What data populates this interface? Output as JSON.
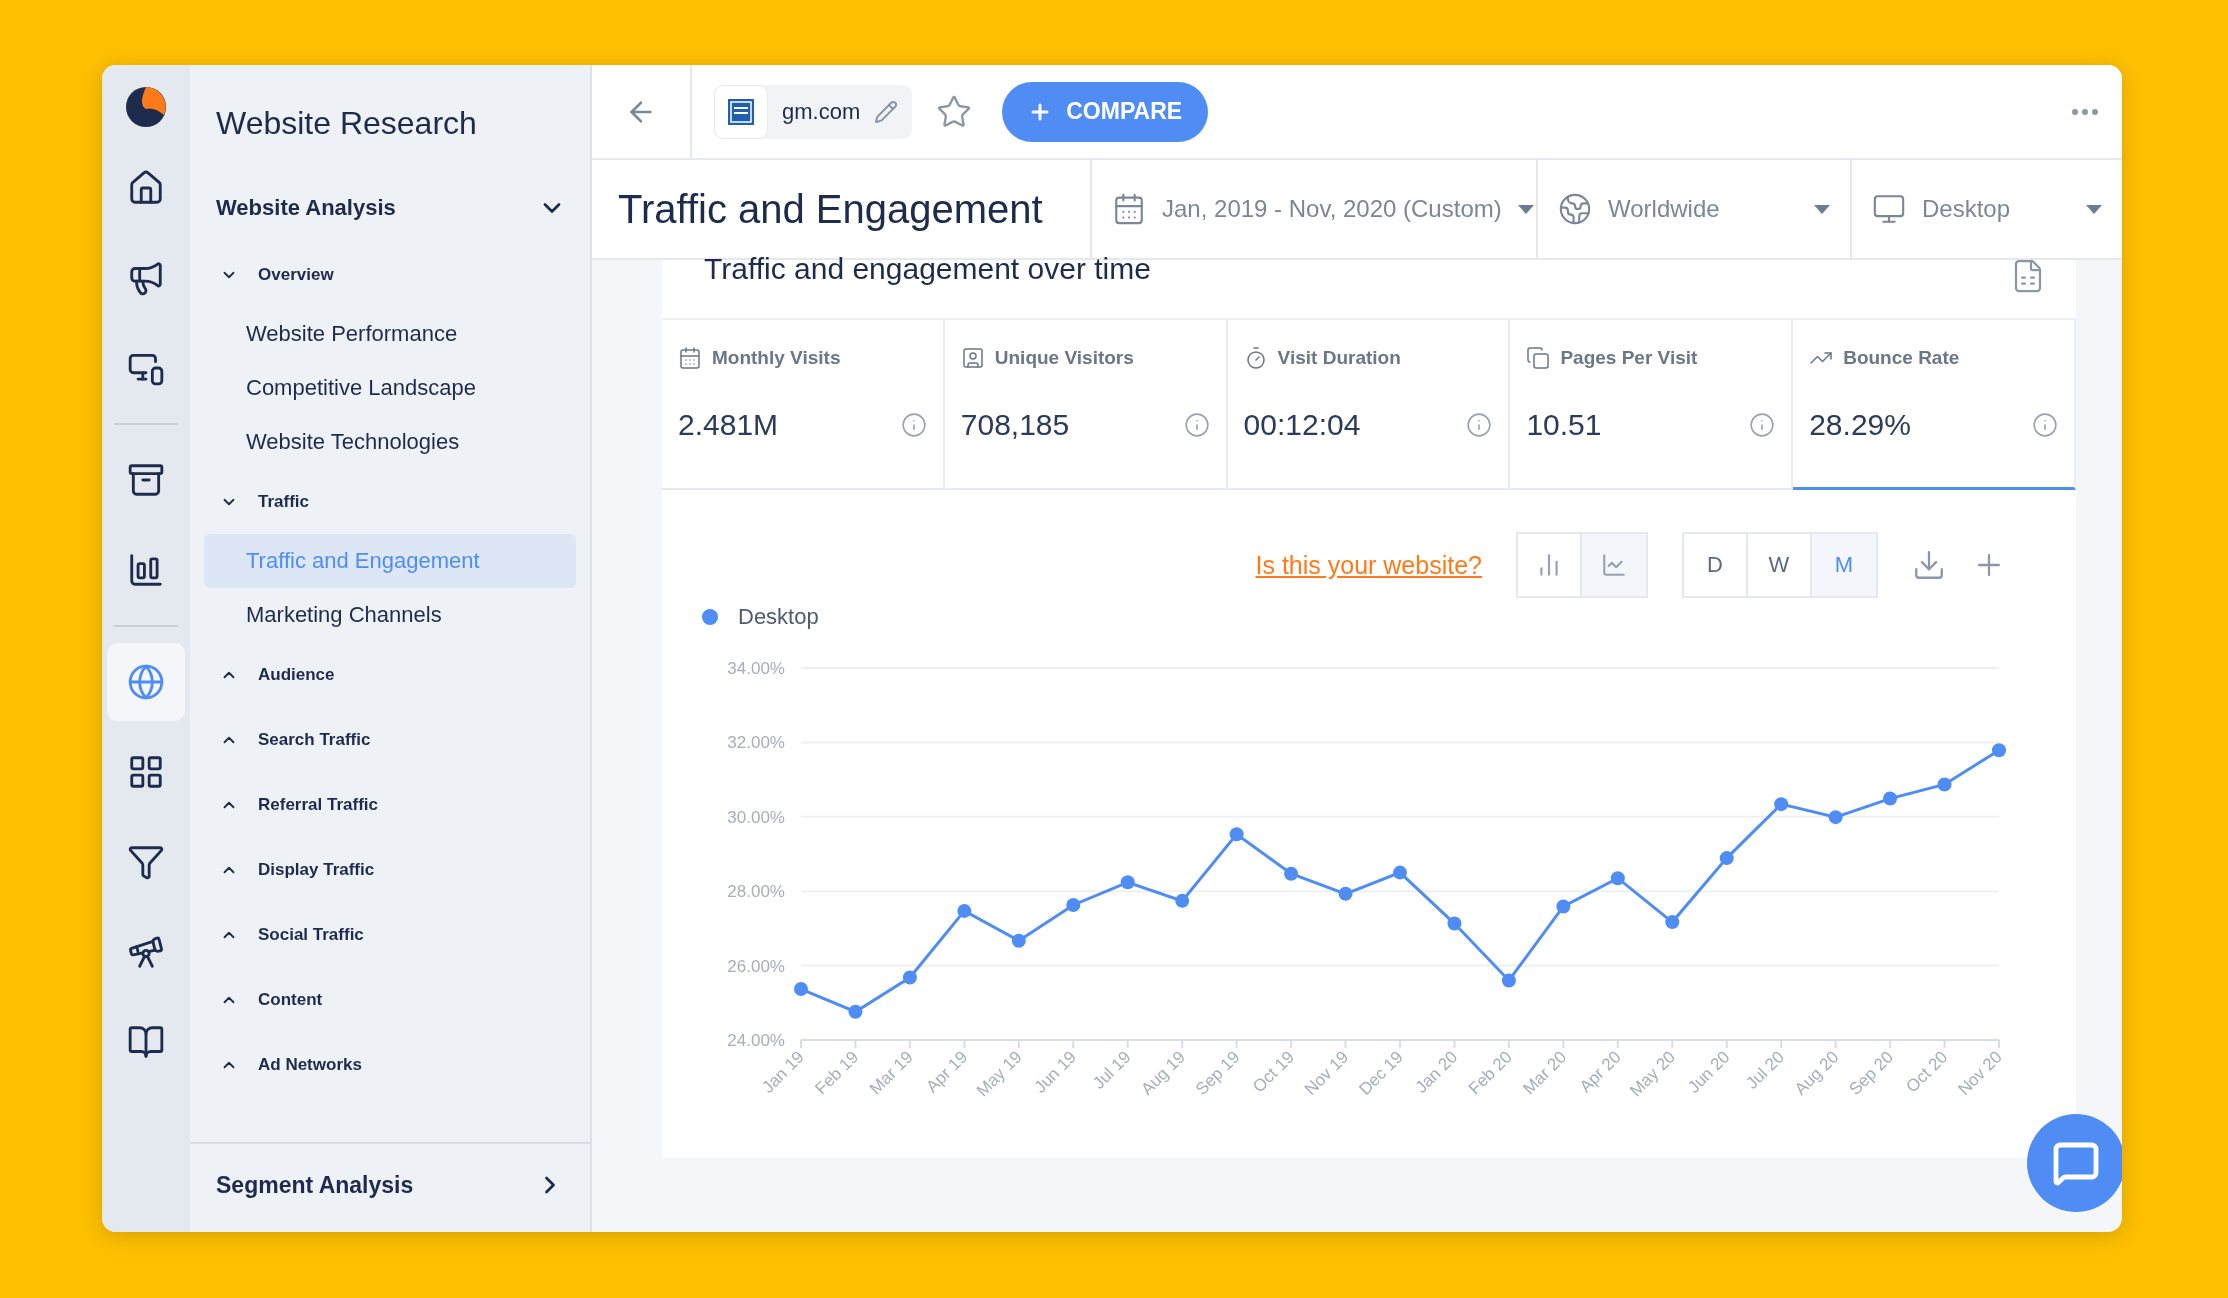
{
  "rail": {
    "groups": [
      [
        {
          "selected": false
        },
        {
          "selected": false
        },
        {
          "selected": false
        }
      ],
      [
        {
          "selected": false
        },
        {
          "selected": false
        }
      ],
      [
        {
          "selected": true
        },
        {
          "selected": false
        },
        {
          "selected": false
        },
        {
          "selected": false
        },
        {
          "selected": false
        }
      ]
    ]
  },
  "sidebar": {
    "title": "Website Research",
    "section": {
      "label": "Website Analysis",
      "expanded": true
    },
    "groups": [
      {
        "label": "Overview",
        "expanded": true,
        "children": [
          {
            "label": "Website Performance",
            "selected": false
          },
          {
            "label": "Competitive Landscape",
            "selected": false
          },
          {
            "label": "Website Technologies",
            "selected": false
          }
        ]
      },
      {
        "label": "Traffic",
        "expanded": true,
        "children": [
          {
            "label": "Traffic and Engagement",
            "selected": true
          },
          {
            "label": "Marketing Channels",
            "selected": false
          }
        ]
      },
      {
        "label": "Audience",
        "expanded": false
      },
      {
        "label": "Search Traffic",
        "expanded": false
      },
      {
        "label": "Referral Traffic",
        "expanded": false
      },
      {
        "label": "Display Traffic",
        "expanded": false
      },
      {
        "label": "Social Traffic",
        "expanded": false
      },
      {
        "label": "Content",
        "expanded": false
      },
      {
        "label": "Ad Networks",
        "expanded": false
      }
    ],
    "footer": "Segment Analysis"
  },
  "topbar": {
    "domain": "gm.com",
    "compare": "COMPARE"
  },
  "header": {
    "title": "Traffic and Engagement",
    "filters": [
      {
        "kind": "date",
        "value": "Jan, 2019 - Nov, 2020 (Custom)"
      },
      {
        "kind": "country",
        "value": "Worldwide"
      },
      {
        "kind": "device",
        "value": "Desktop"
      }
    ]
  },
  "card": {
    "title": "Traffic and engagement over time",
    "metrics": [
      {
        "label": "Monthly Visits",
        "value": "2.481M",
        "selected": false
      },
      {
        "label": "Unique Visitors",
        "value": "708,185",
        "selected": false
      },
      {
        "label": "Visit Duration",
        "value": "00:12:04",
        "selected": false
      },
      {
        "label": "Pages Per Visit",
        "value": "10.51",
        "selected": false
      },
      {
        "label": "Bounce Rate",
        "value": "28.29%",
        "selected": true
      }
    ],
    "claim_link": "Is this your website?",
    "chart_types": [
      {
        "kind": "bar",
        "selected": false
      },
      {
        "kind": "line",
        "selected": true
      }
    ],
    "granularity": [
      {
        "label": "D",
        "selected": false
      },
      {
        "label": "W",
        "selected": false
      },
      {
        "label": "M",
        "selected": true
      }
    ],
    "chart_data": {
      "type": "line",
      "categories": [
        "Jan 19",
        "Feb 19",
        "Mar 19",
        "Apr 19",
        "May 19",
        "Jun 19",
        "Jul 19",
        "Aug 19",
        "Sep 19",
        "Oct 19",
        "Nov 19",
        "Dec 19",
        "Jan 20",
        "Feb 20",
        "Mar 20",
        "Apr 20",
        "May 20",
        "Jun 20",
        "Jul 20",
        "Aug 20",
        "Sep 20",
        "Oct 20",
        "Nov 20"
      ],
      "grid": true,
      "series": [
        {
          "name": "Desktop",
          "color": "#4f8df5",
          "marker": "circle",
          "values": [
            25.37,
            24.76,
            25.68,
            27.47,
            26.67,
            27.63,
            28.24,
            27.74,
            29.53,
            28.47,
            27.93,
            28.5,
            27.13,
            25.6,
            27.59,
            28.35,
            27.17,
            28.89,
            30.34,
            29.99,
            30.49,
            30.87,
            31.79
          ]
        }
      ],
      "ylim": [
        24,
        34
      ],
      "yticks": [
        {
          "value": 24,
          "label": "24.00%"
        },
        {
          "value": 26,
          "label": "26.00%"
        },
        {
          "value": 28,
          "label": "28.00%"
        },
        {
          "value": 30,
          "label": "30.00%"
        },
        {
          "value": 32,
          "label": "32.00%"
        },
        {
          "value": 34,
          "label": "34.00%"
        }
      ]
    }
  }
}
